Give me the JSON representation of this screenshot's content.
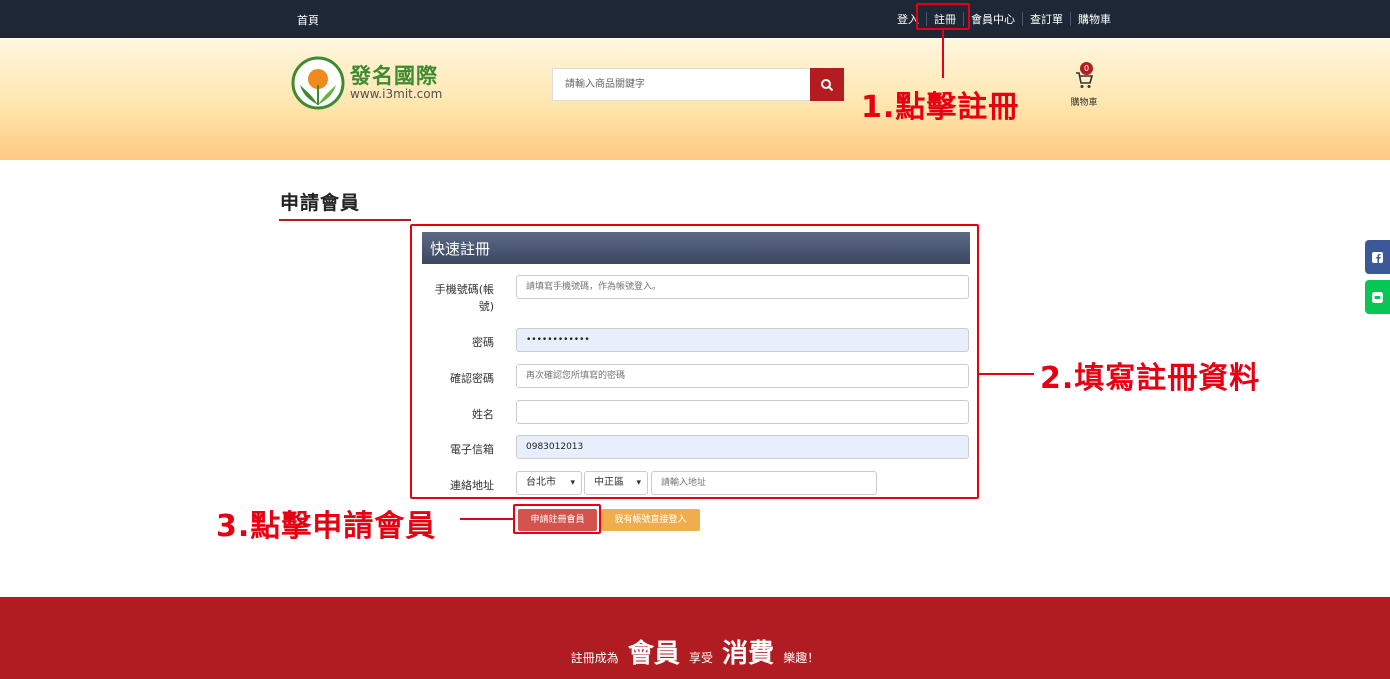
{
  "topbar": {
    "home": "首頁",
    "nav": [
      "登入",
      "註冊",
      "會員中心",
      "查訂單",
      "購物車"
    ]
  },
  "header": {
    "logo_title": "發名國際",
    "logo_url": "www.i3mit.com",
    "search_placeholder": "請輸入商品關鍵字",
    "cart_count": "0",
    "cart_label": "購物車"
  },
  "main": {
    "page_title": "申請會員",
    "panel_title": "快速註冊",
    "fields": {
      "phone_label": "手機號碼(帳號)",
      "phone_placeholder": "請填寫手機號碼，作為帳號登入。",
      "password_label": "密碼",
      "password_value": "••••••••••••",
      "confirm_label": "確認密碼",
      "confirm_placeholder": "再次確認您所填寫的密碼",
      "name_label": "姓名",
      "name_value": "",
      "email_label": "電子信箱",
      "email_value": "0983012013",
      "address_label": "連絡地址",
      "city_value": "台北市",
      "district_value": "中正區",
      "address_placeholder": "請輸入地址"
    },
    "register_button": "申請註冊會員",
    "login_button": "我有帳號直接登入"
  },
  "annotations": {
    "step1": "1.點擊註冊",
    "step2": "2.填寫註冊資料",
    "step3": "3.點擊申請會員"
  },
  "footer": {
    "part1": "註冊成為",
    "part2": "會員",
    "part3": "享受",
    "part4": "消費",
    "part5": "樂趣！"
  },
  "colors": {
    "topbar": "#1d2735",
    "brand_red": "#b51c22",
    "annotation": "#e60012",
    "footer": "#b01c22"
  }
}
